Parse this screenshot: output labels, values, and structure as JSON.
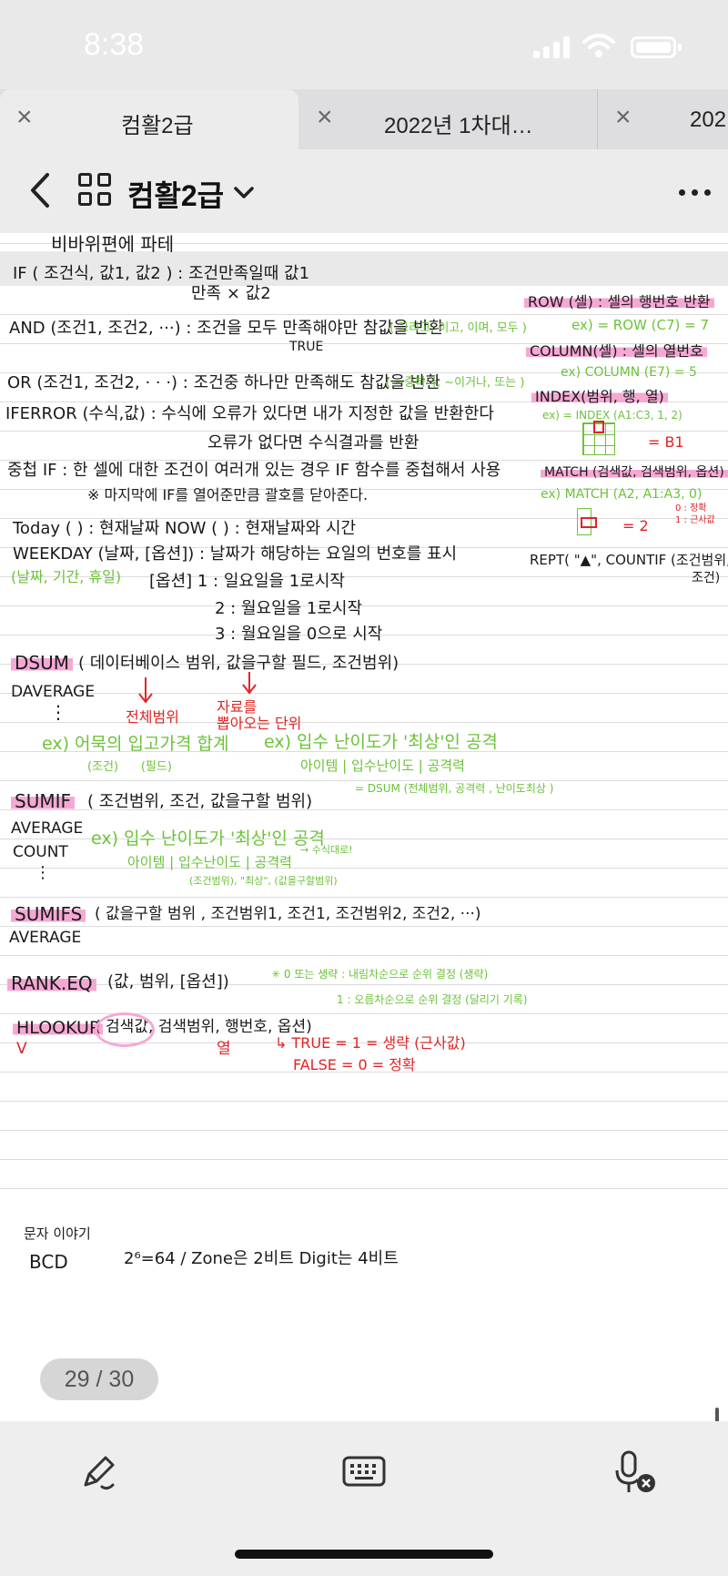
{
  "status": {
    "time": "8:38"
  },
  "tabs": [
    {
      "label": "컴활2급",
      "active": true
    },
    {
      "label": "2022년 1차대…",
      "active": false
    },
    {
      "label": "202",
      "active": false
    }
  ],
  "nav": {
    "title": "컴활2급"
  },
  "icons": [
    "close-icon",
    "chevron-left-icon",
    "grid-icon",
    "chevron-down-icon",
    "more-icon",
    "pen-icon",
    "keyboard-icon",
    "mic-off-icon"
  ],
  "colors": {
    "ink": "#1a1a1a",
    "green": "#6cc23a",
    "red": "#e02424",
    "highlight": "#f6a8d4"
  },
  "notes": {
    "top": "비바위편에 파테",
    "if_line": "IF ( 조건식, 값1, 값2 ) : 조건만족일때 값1",
    "if_line2": "만족 ×  값2",
    "and_line": "AND (조건1, 조건2, ···) : 조건을 모두 만족해야만 참값을 반환",
    "and_true": "TRUE",
    "and_note": "( 그리고, 이고, 이며, 모두 )",
    "or_line": "OR (조건1, 조건2, · · ·) : 조건중 하나만 만족해도 참값을 반환",
    "or_note": "( ~중하나, ~이거나, 또는 )",
    "iferror_line": "IFERROR (수식,값) : 수식에 오류가 있다면 내가 지정한 값을 반환한다",
    "iferror_line2": "오류가 없다면  수식결과를 반환",
    "nested_line": "중첩 IF : 한 셀에 대한 조건이 여러개 있는 경우 IF 함수를 중첩해서 사용",
    "nested_line2": "※ 마지막에 IF를 열어준만큼 괄호를 닫아준다.",
    "today_line": "Today ( ) : 현재날짜      NOW ( ) : 현재날짜와 시간",
    "weekday_line": "WEEKDAY (날짜, [옵션]) : 날짜가 해당하는 요일의 번호를 표시",
    "weekday_note": "(날짜, 기간, 휴일)",
    "weekday_opt": "[옵션]   1 : 일요일을 1로시작",
    "weekday_opt2": "2 : 월요일을 1로시작",
    "weekday_opt3": "3 : 월요일을 0으로 시작",
    "dsum_fn": "DSUM",
    "dsum_args": "( 데이터베이스 범위, 값을구할 필드, 조건범위)",
    "daverage": "DAVERAGE",
    "dots": "⋮",
    "red_total": "전체범위",
    "red_field": "자료를\n뽑아오는 단위",
    "dsum_ex1": "ex) 어묵의 입고가격 합계",
    "dsum_ex1_sub": "(조건)      (필드)",
    "dsum_ex2": "ex)  입수 난이도가 '최상'인 공격",
    "dsum_ex2_b": "아이템  | 입수난이도 | 공격력",
    "dsum_ex2_c": "= DSUM (전체범위, 공격력 , 난이도최상 )",
    "sumif_fn": "SUMIF",
    "sumif_args": "( 조건범위, 조건, 값을구할 범위)",
    "average": "AVERAGE",
    "count": "COUNT",
    "sumif_ex": "ex)  입수 난이도가 '최상'인 공격",
    "sumif_ex_b": "아이템  | 입수난이도 | 공격력",
    "sumif_ex_c": "(조건범위), \"최상\", (값을구할범위)",
    "sumif_ex_arrow": "→ 수식대로!",
    "sumifs_fn": "SUMIFS",
    "sumifs_args": "( 값을구할 범위 , 조건범위1, 조건1, 조건범위2, 조건2, ···)",
    "average2": "AVERAGE",
    "rank_fn": "RANK.EQ",
    "rank_args": "(값, 범위, [옵션])",
    "rank_note1": "✳ 0 또는 생략 : 내림차순으로 순위 결정 (생략)",
    "rank_note2": "1  :  오름차순으로 순위 결정 (달리기 기록)",
    "hlookup_fn": "HLOOKUP",
    "hlookup_args": "( 검색값, 검색범위, 행번호, 옵션)",
    "hlookup_v": "V",
    "hlookup_col": "열",
    "hlookup_red1": "↳ TRUE = 1 = 생략 (근사값)",
    "hlookup_red2": "FALSE = 0 = 정확",
    "row_fn": "ROW (셀) : 셀의 행번호 반환",
    "row_ex": "ex) = ROW (C7) = 7",
    "col_fn": "COLUMN(셀) : 셀의 열번호",
    "col_ex": "ex) COLUMN (E7) = 5",
    "index_fn": "INDEX(범위, 행, 열)",
    "index_ex": "ex) = INDEX (A1:C3, 1, 2)",
    "index_res": "= B1",
    "match_fn": "MATCH (검색값, 검색범위, 옵션)",
    "match_ex": "ex) MATCH (A2, A1:A3, 0)",
    "match_res": "= 2",
    "match_opt": "0 : 정확\n1 : 근사값",
    "rept_fn": "REPT( \"▲\", COUNTIF (조건범위,",
    "rept_fn2": "조건)",
    "next_title": "문자 이야기",
    "next_line": "BCD",
    "next_line2": "2⁶=64 / Zone은 2비트  Digit는 4비트"
  },
  "page_indicator": "29 / 30"
}
